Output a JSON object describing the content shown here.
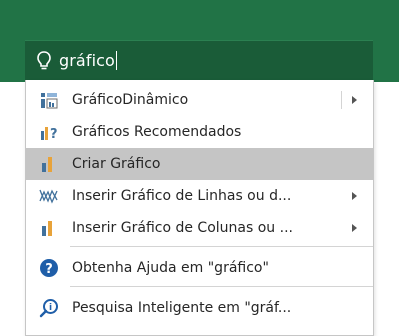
{
  "search": {
    "query": "gráfico"
  },
  "menu": {
    "items": [
      {
        "label": "GráficoDinâmico",
        "has_submenu": true,
        "icon": "pivot-chart-icon"
      },
      {
        "label": "Gráficos Recomendados",
        "has_submenu": false,
        "icon": "recommended-charts-icon"
      },
      {
        "label": "Criar Gráfico",
        "has_submenu": false,
        "selected": true,
        "icon": "create-chart-icon"
      },
      {
        "label": "Inserir Gráfico de Linhas ou d...",
        "has_submenu": true,
        "icon": "line-chart-icon"
      },
      {
        "label": "Inserir Gráfico de Colunas ou ...",
        "has_submenu": true,
        "icon": "column-chart-icon"
      },
      {
        "label": "Obtenha Ajuda em \"gráfico\"",
        "has_submenu": false,
        "icon": "help-icon"
      },
      {
        "label": "Pesquisa Inteligente em \"gráf...",
        "has_submenu": false,
        "icon": "smart-lookup-icon"
      }
    ]
  },
  "colors": {
    "ribbon_green": "#217346",
    "search_box": "#1a5c38",
    "selected_row": "#c5c5c5",
    "chart_blue": "#41719c",
    "chart_orange": "#e8a33a",
    "help_blue": "#1f5ea8"
  }
}
